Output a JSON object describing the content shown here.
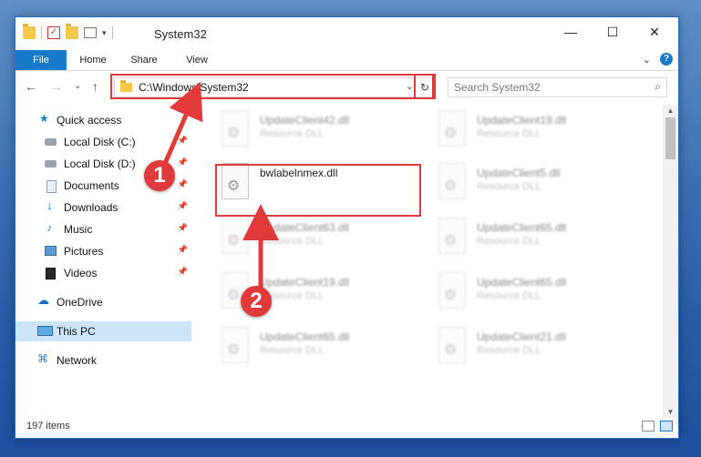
{
  "window": {
    "title": "System32",
    "controls": {
      "minimize": "—",
      "maximize": "☐",
      "close": "✕"
    }
  },
  "ribbon": {
    "tabs": [
      "File",
      "Home",
      "Share",
      "View"
    ],
    "expand_glyph": "⌄",
    "help_glyph": "?"
  },
  "address": {
    "path": "C:\\Windows\\System32",
    "dropdown_glyph": "⌄",
    "refresh_glyph": "↻"
  },
  "search": {
    "placeholder": "Search System32",
    "icon_glyph": "⌕"
  },
  "nav": {
    "back": "←",
    "forward": "→",
    "recent": "⌄",
    "up": "↑"
  },
  "sidebar": {
    "items": [
      {
        "label": "Quick access",
        "icon": "star-icon",
        "glyph": "★",
        "pinned": false
      },
      {
        "label": "Local Disk (C:)",
        "icon": "disk-icon",
        "pinned": true
      },
      {
        "label": "Local Disk (D:)",
        "icon": "disk-icon",
        "pinned": true
      },
      {
        "label": "Documents",
        "icon": "document-icon",
        "pinned": true
      },
      {
        "label": "Downloads",
        "icon": "download-icon",
        "glyph": "↓",
        "pinned": true
      },
      {
        "label": "Music",
        "icon": "music-icon",
        "glyph": "♪",
        "pinned": true
      },
      {
        "label": "Pictures",
        "icon": "pictures-icon",
        "pinned": true
      },
      {
        "label": "Videos",
        "icon": "videos-icon",
        "pinned": true
      },
      {
        "label": "OneDrive",
        "icon": "cloud-icon",
        "glyph": "☁",
        "pinned": false
      },
      {
        "label": "This PC",
        "icon": "pc-icon",
        "pinned": false,
        "selected": true
      },
      {
        "label": "Network",
        "icon": "network-icon",
        "glyph": "⌘",
        "pinned": false
      }
    ],
    "pin_glyph": "📌"
  },
  "files": [
    {
      "name": "UpdateClient42.dll",
      "type": "Resource DLL",
      "blurred": true
    },
    {
      "name": "UpdateClient19.dll",
      "type": "Resource DLL",
      "blurred": true
    },
    {
      "name": "bwlabelnmex.dll",
      "type": "",
      "blurred": false,
      "highlighted": true
    },
    {
      "name": "UpdateClient5.dll",
      "type": "Resource DLL",
      "blurred": true
    },
    {
      "name": "UpdateClient63.dll",
      "type": "Resource DLL",
      "blurred": true
    },
    {
      "name": "UpdateClient65.dll",
      "type": "Resource DLL",
      "blurred": true
    },
    {
      "name": "UpdateClient19.dll",
      "type": "Resource DLL",
      "blurred": true
    },
    {
      "name": "UpdateClient65.dll",
      "type": "Resource DLL",
      "blurred": true
    },
    {
      "name": "UpdateClient65.dll",
      "type": "Resource DLL",
      "blurred": true
    },
    {
      "name": "UpdateClient21.dll",
      "type": "Resource DLL",
      "blurred": true
    }
  ],
  "status": {
    "item_count": "197 items"
  },
  "annotations": {
    "step1": "1",
    "step2": "2",
    "accent_color": "#e03a3a"
  },
  "colors": {
    "file_tab": "#1979ca",
    "selected_nav": "#cce4f7"
  }
}
